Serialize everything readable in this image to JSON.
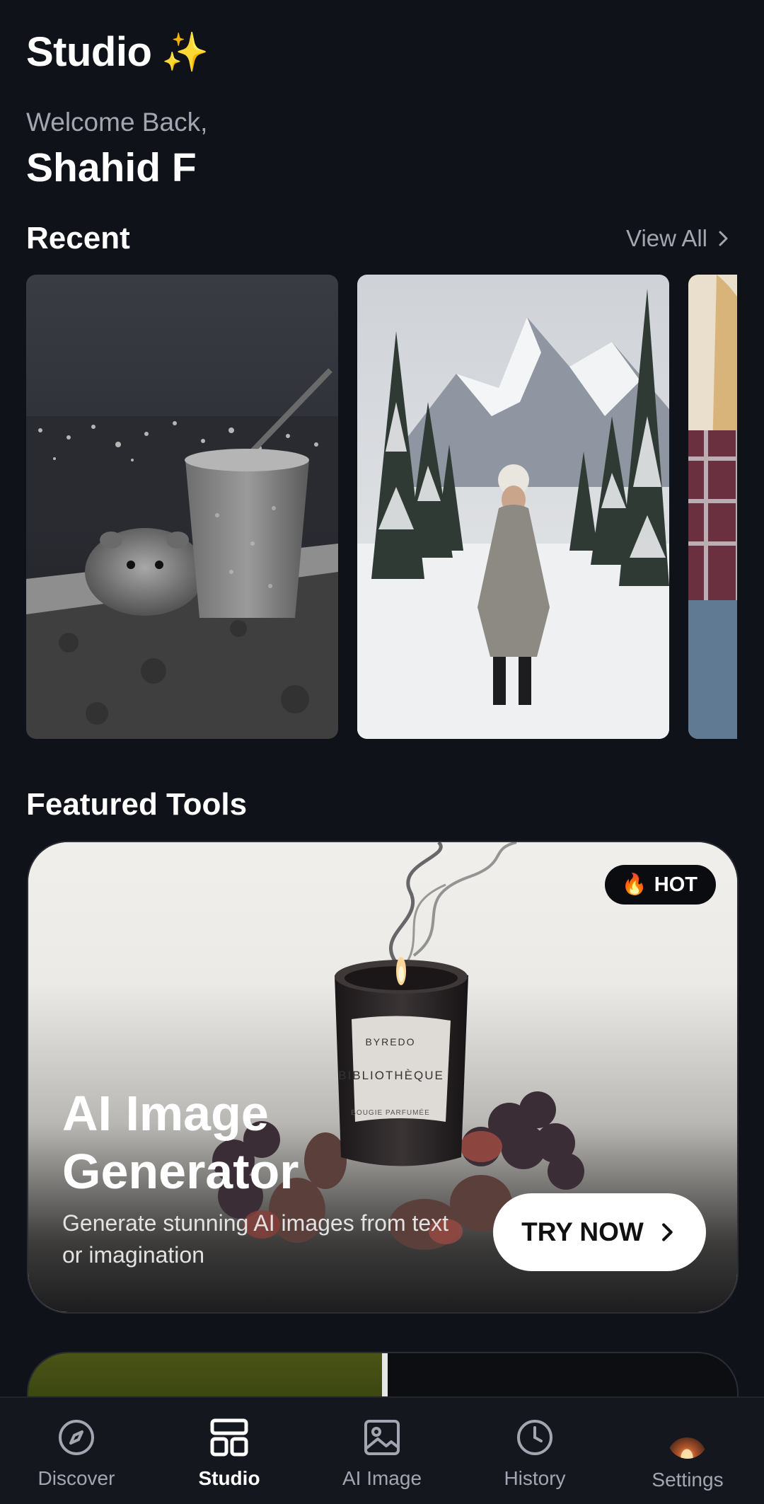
{
  "header": {
    "title": "Studio",
    "title_emoji": "✨",
    "welcome": "Welcome Back,",
    "username": "Shahid F"
  },
  "recent": {
    "title": "Recent",
    "view_all": "View All",
    "items": [
      {
        "subject": "hamster-with-iced-drink"
      },
      {
        "subject": "woman-in-snowy-mountains"
      },
      {
        "subject": "woman-in-plaid-shirt"
      }
    ]
  },
  "featured": {
    "title": "Featured Tools",
    "card": {
      "badge_icon": "🔥",
      "badge": "HOT",
      "title": "AI Image Generator",
      "description": "Generate stunning AI images from text or imagination",
      "button": "TRY NOW",
      "image_text": {
        "brand": "BYREDO",
        "product": "BIBLIOTHÈQUE",
        "subtitle": "BOUGIE PARFUMÉE"
      }
    }
  },
  "nav": {
    "items": [
      {
        "label": "Discover",
        "icon": "compass-icon",
        "active": false
      },
      {
        "label": "Studio",
        "icon": "layout-grid-icon",
        "active": true
      },
      {
        "label": "AI Image",
        "icon": "image-icon",
        "active": false
      },
      {
        "label": "History",
        "icon": "clock-icon",
        "active": false
      },
      {
        "label": "Settings",
        "icon": "avatar",
        "active": false
      }
    ]
  },
  "colors": {
    "background": "#10121a",
    "nav_background": "#15171f",
    "muted_text": "#a3a6b1",
    "badge_background": "#0b0c10"
  }
}
